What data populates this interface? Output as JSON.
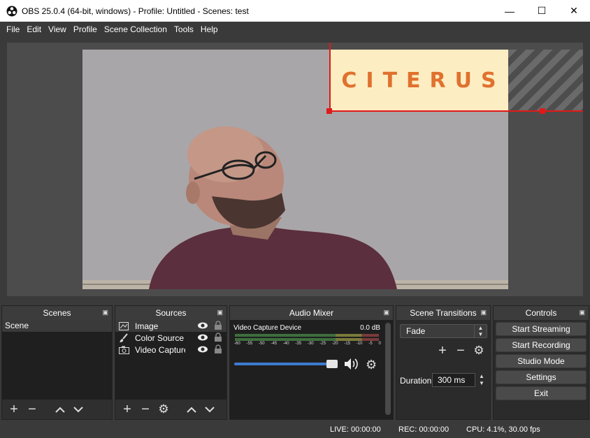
{
  "window": {
    "title": "OBS 25.0.4 (64-bit, windows) - Profile: Untitled - Scenes: test",
    "minimize": "—",
    "maximize": "☐",
    "close": "✕"
  },
  "menu": [
    {
      "label": "File"
    },
    {
      "label": "Edit"
    },
    {
      "label": "View"
    },
    {
      "label": "Profile"
    },
    {
      "label": "Scene Collection"
    },
    {
      "label": "Tools"
    },
    {
      "label": "Help"
    }
  ],
  "preview": {
    "logo_text": "CITERUS"
  },
  "docks": {
    "scenes": {
      "title": "Scenes",
      "items": [
        "Scene"
      ]
    },
    "sources": {
      "title": "Sources",
      "items": [
        {
          "name": "Image",
          "icon": "image-icon"
        },
        {
          "name": "Color Source",
          "icon": "brush-icon"
        },
        {
          "name": "Video Capture Device",
          "icon": "camera-icon"
        }
      ]
    },
    "mixer": {
      "title": "Audio Mixer",
      "channel": "Video Capture Device",
      "db": "0.0 dB",
      "scale": [
        "-60",
        "-55",
        "-50",
        "-45",
        "-40",
        "-35",
        "-30",
        "-25",
        "-20",
        "-15",
        "-10",
        "-5",
        "0"
      ]
    },
    "transitions": {
      "title": "Scene Transitions",
      "selected": "Fade",
      "duration_label": "Duration",
      "duration_value": "300 ms"
    },
    "controls": {
      "title": "Controls",
      "buttons": [
        "Start Streaming",
        "Start Recording",
        "Studio Mode",
        "Settings",
        "Exit"
      ]
    }
  },
  "status": {
    "live": "LIVE: 00:00:00",
    "rec": "REC: 00:00:00",
    "cpu": "CPU: 4.1%, 30.00 fps"
  },
  "colors": {
    "accent_red": "#e01919",
    "logo_orange": "#e0712e",
    "logo_bg": "#fdedc2",
    "volume_blue": "#3d7bd0"
  }
}
